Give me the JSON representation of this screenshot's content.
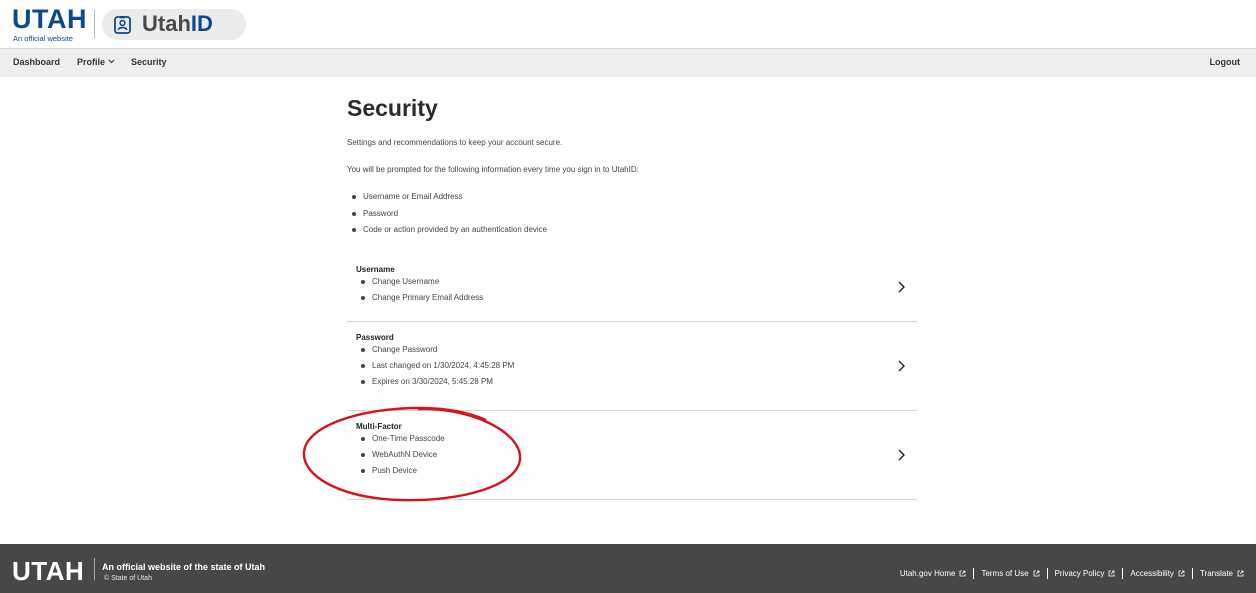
{
  "header": {
    "utah_logo": "UTAH",
    "utah_tagline": "An official website",
    "app_name_main": "Utah",
    "app_name_accent": "ID"
  },
  "nav": {
    "items": [
      {
        "label": "Dashboard"
      },
      {
        "label": "Profile",
        "icon": "chevron-down-icon"
      },
      {
        "label": "Security"
      }
    ],
    "logout": "Logout"
  },
  "main": {
    "title": "Security",
    "subtitle": "Settings and recommendations to keep your account secure.",
    "prompt": "You will be prompted for the following information every time you sign in to UtahID:",
    "prompt_items": [
      "Username or Email Address",
      "Password",
      "Code or action provided by an authentication device"
    ],
    "cards": [
      {
        "title": "Username",
        "items": [
          "Change Username",
          "Change Primary Email Address"
        ]
      },
      {
        "title": "Password",
        "items": [
          "Change Password",
          "Last changed on 1/30/2024, 4:45:28 PM",
          "Expires on 3/30/2024, 5:45:28 PM"
        ]
      },
      {
        "title": "Multi-Factor",
        "items": [
          "One-Time Passcode",
          "WebAuthN Device",
          "Push Device"
        ]
      }
    ]
  },
  "footer": {
    "utah_logo": "UTAH",
    "official": "An official website of the state of Utah",
    "copyright": "© State of Utah",
    "links": [
      "Utah.gov Home",
      "Terms of Use",
      "Privacy Policy",
      "Accessibility",
      "Translate"
    ]
  },
  "colors": {
    "brand_blue": "#0b4a8e",
    "nav_bg": "#eeeeee",
    "footer_bg": "#474747",
    "annotation_red": "#d6141c"
  }
}
